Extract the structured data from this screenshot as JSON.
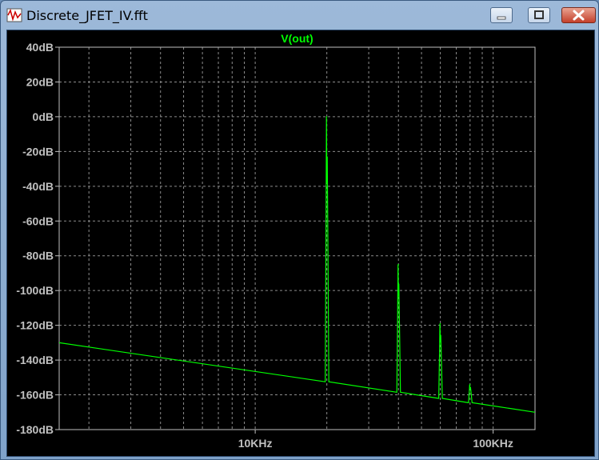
{
  "window": {
    "title": "Discrete_JFET_IV.fft",
    "icon": "ltspice-waveform-icon",
    "controls": [
      "minimize-icon",
      "maximize-icon",
      "close-icon"
    ]
  },
  "colors": {
    "trace": "#00ff00",
    "background": "#000000",
    "grid": "#8c8c8c",
    "axis_text": "#c0c0c0"
  },
  "chart_data": {
    "type": "line",
    "title": "V(out)",
    "xlabel": "",
    "ylabel": "",
    "x_scale": "log",
    "xlim": [
      1500,
      150000
    ],
    "ylim": [
      -180,
      40
    ],
    "grid": true,
    "x_ticks": [
      {
        "value": 10000,
        "label": "10KHz"
      },
      {
        "value": 100000,
        "label": "100KHz"
      }
    ],
    "y_ticks": [
      {
        "value": 40,
        "label": "40dB"
      },
      {
        "value": 20,
        "label": "20dB"
      },
      {
        "value": 0,
        "label": "0dB"
      },
      {
        "value": -20,
        "label": "-20dB"
      },
      {
        "value": -40,
        "label": "-40dB"
      },
      {
        "value": -60,
        "label": "-60dB"
      },
      {
        "value": -80,
        "label": "-80dB"
      },
      {
        "value": -100,
        "label": "-100dB"
      },
      {
        "value": -120,
        "label": "-120dB"
      },
      {
        "value": -140,
        "label": "-140dB"
      },
      {
        "value": -160,
        "label": "-160dB"
      },
      {
        "value": -180,
        "label": "-180dB"
      }
    ],
    "series": [
      {
        "noise_floor": [
          [
            1500,
            -130
          ],
          [
            150000,
            -170
          ]
        ],
        "peaks": [
          {
            "x": 20000,
            "y": 0
          },
          {
            "x": 40000,
            "y": -85
          },
          {
            "x": 60000,
            "y": -119
          },
          {
            "x": 80000,
            "y": -154
          }
        ]
      }
    ]
  }
}
